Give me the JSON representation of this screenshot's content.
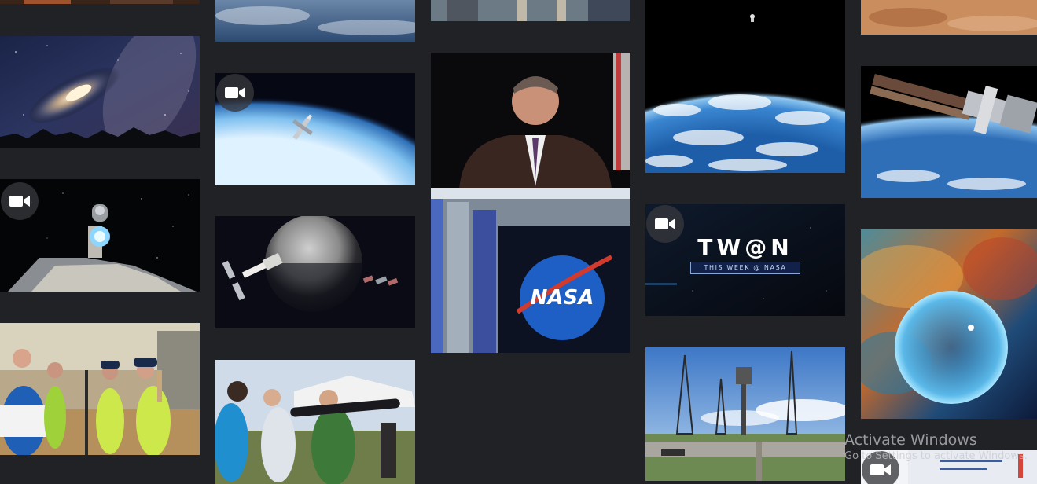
{
  "twan": {
    "title": "TW@N",
    "subtitle": "THIS WEEK @ NASA"
  },
  "nasa_logo": {
    "text": "NASA"
  },
  "watermark": {
    "title": "Activate Windows",
    "subtitle": "Go to Settings to activate Windows."
  },
  "colors": {
    "background": "#212226",
    "video_badge": "#37373c"
  },
  "icons": {
    "video": "video-camera-icon"
  }
}
